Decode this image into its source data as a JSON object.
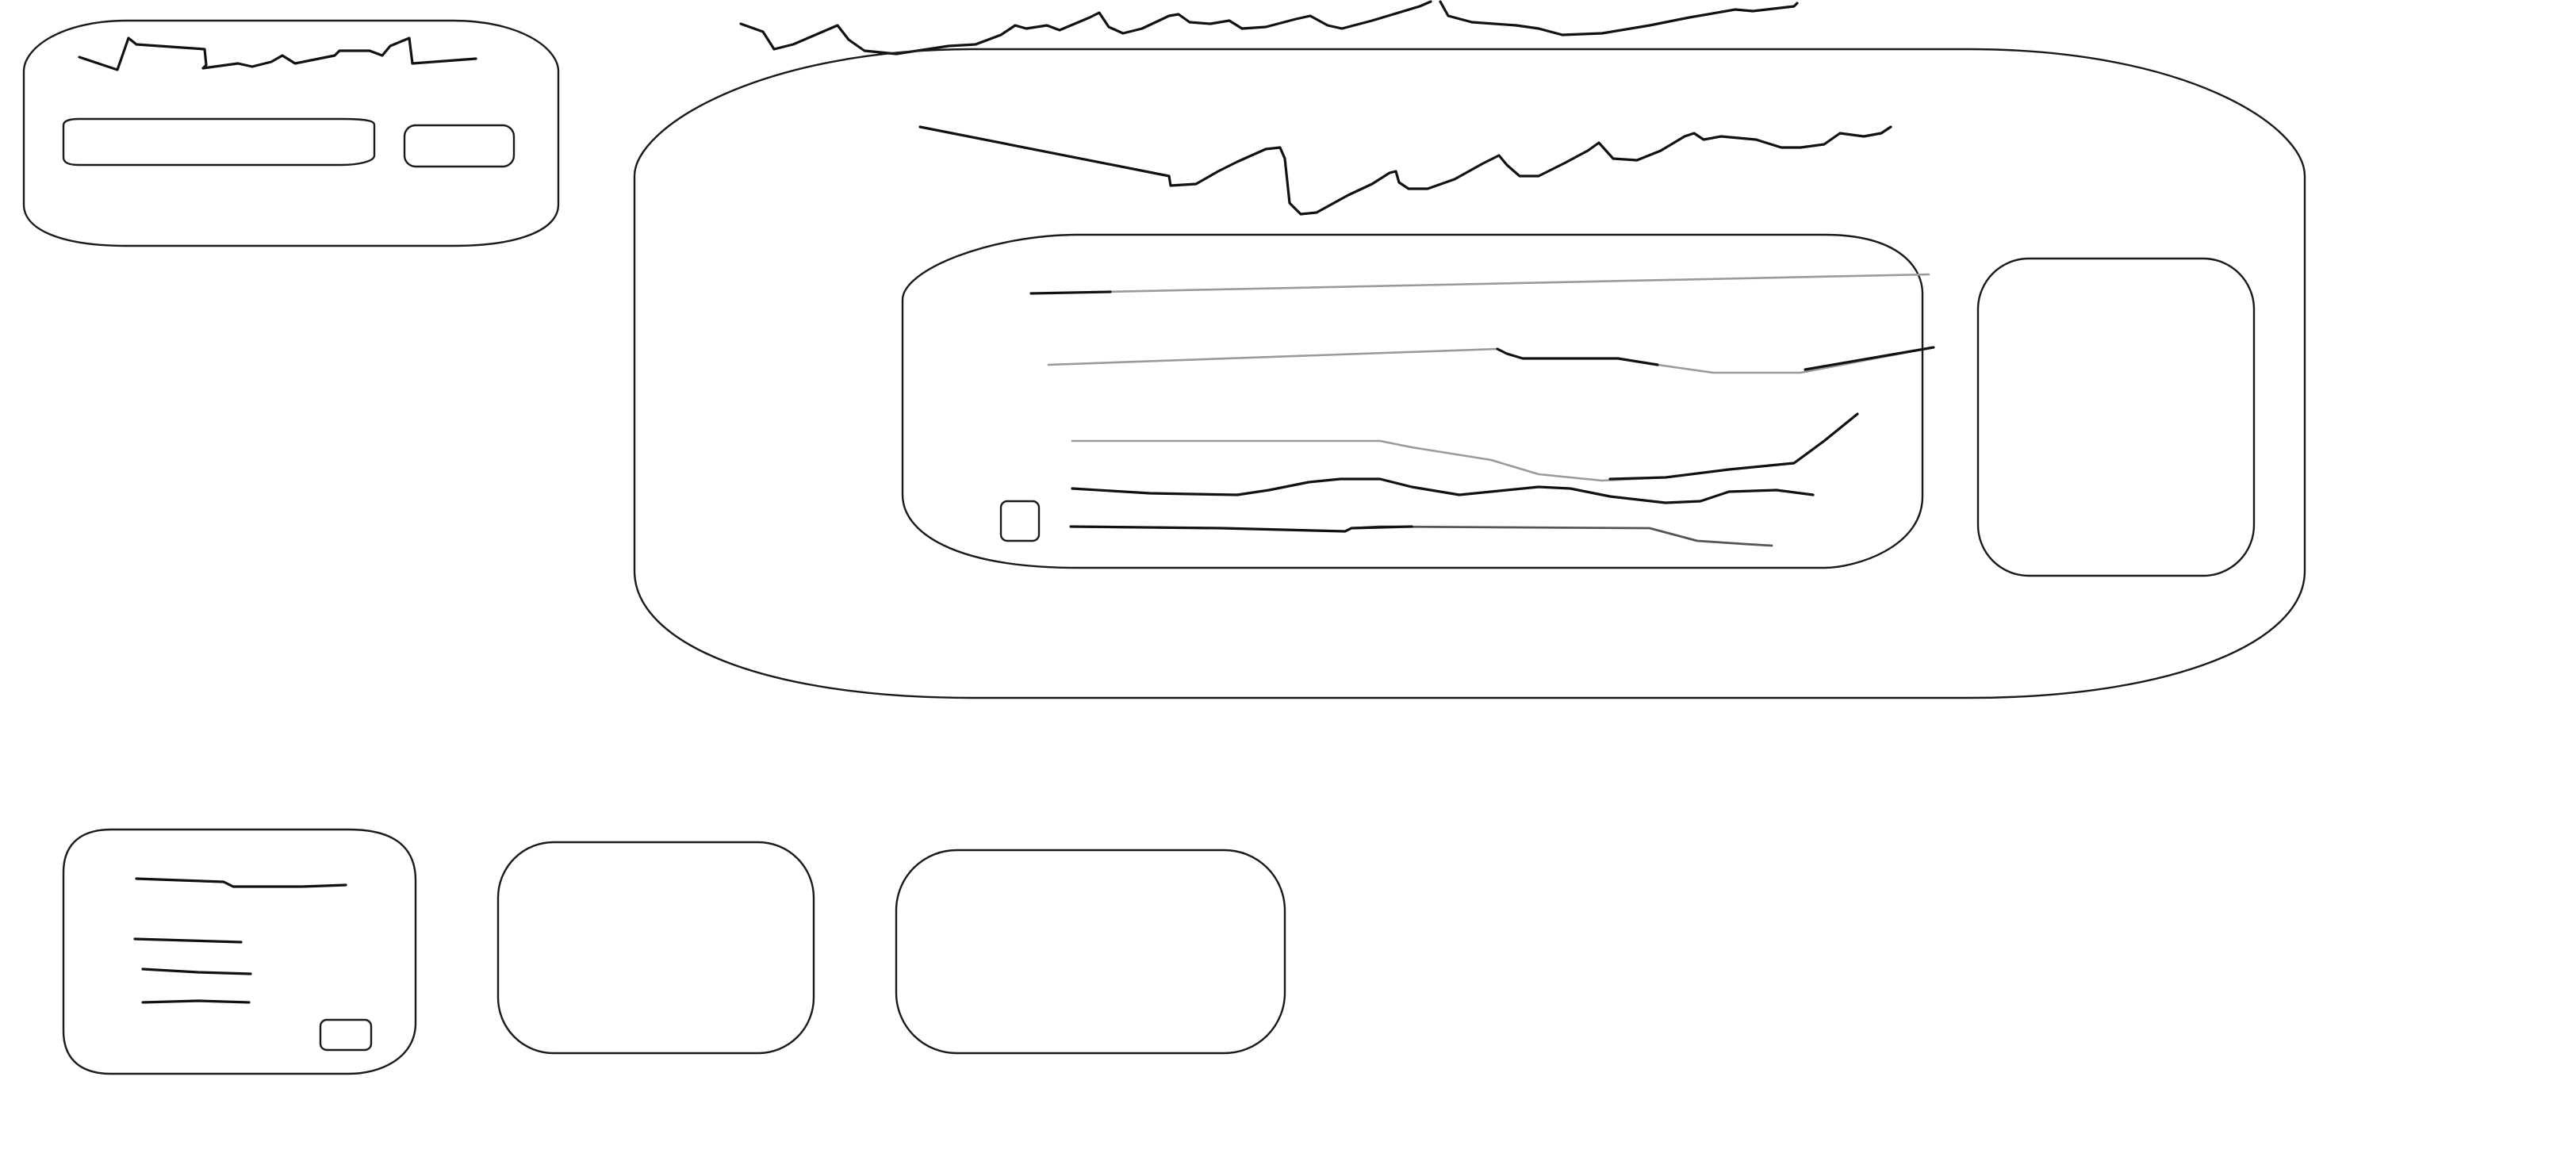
{
  "ink_color": "#111111",
  "faint_ink_color": "#9a9a9a",
  "box_color": "#1a1a1a",
  "background_color": "#ffffff"
}
